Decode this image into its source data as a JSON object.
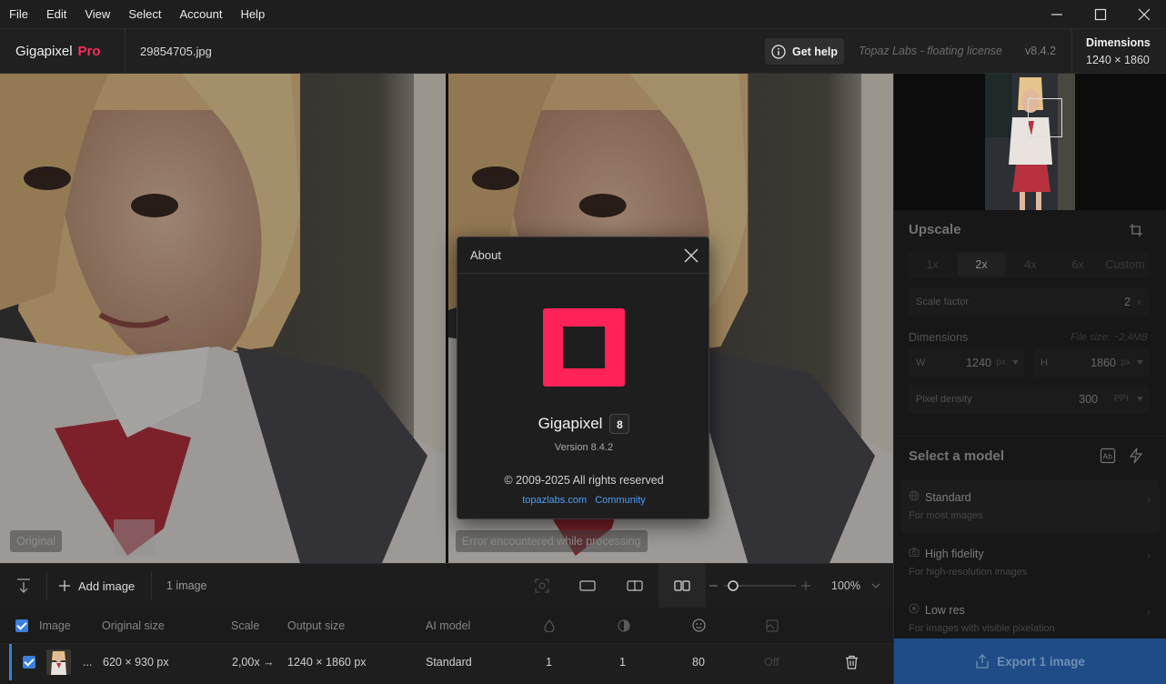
{
  "menu": [
    "File",
    "Edit",
    "View",
    "Select",
    "Account",
    "Help"
  ],
  "header": {
    "brand": "Gigapixel",
    "brand_tier": "Pro",
    "filename": "29854705.jpg",
    "get_help": "Get help",
    "license": "Topaz Labs - floating license",
    "version": "v8.4.2",
    "dimensions_title": "Dimensions",
    "dimensions_value": "1240 × 1860"
  },
  "canvas": {
    "left_tag": "Original",
    "right_tag": "Error encountered while processing"
  },
  "about": {
    "title": "About",
    "app_name": "Gigapixel",
    "major_version": "8",
    "version": "Version 8.4.2",
    "copyright": "© 2009-2025 All rights reserved",
    "link_site": "topazlabs.com",
    "link_community": "Community",
    "logo_color": "#ff2258"
  },
  "toolbar": {
    "add_image": "Add image",
    "image_count": "1 image",
    "zoom": "100%"
  },
  "table": {
    "headers": {
      "image": "Image",
      "original_size": "Original size",
      "scale": "Scale",
      "output_size": "Output size",
      "ai_model": "AI model"
    },
    "row": {
      "ellipsis": "...",
      "original_size": "620 × 930 px",
      "scale": "2,00x →",
      "output_size": "1240 × 1860 px",
      "ai_model": "Standard",
      "col1": "1",
      "col2": "1",
      "col3": "80",
      "col4": "Off"
    }
  },
  "sidebar": {
    "upscale_title": "Upscale",
    "scale_options": [
      "1x",
      "2x",
      "4x",
      "6x",
      "Custom"
    ],
    "scale_selected": "2x",
    "scale_factor_label": "Scale factor",
    "scale_factor_value": "2",
    "scale_factor_unit": "x",
    "dimensions_label": "Dimensions",
    "file_size": "File size: ~2,4MB",
    "w_label": "W",
    "w_value": "1240",
    "w_unit": "px",
    "h_label": "H",
    "h_value": "1860",
    "h_unit": "px",
    "pixel_density_label": "Pixel density",
    "pixel_density_value": "300",
    "pixel_density_unit": "PPI",
    "select_model_title": "Select a model",
    "models": [
      {
        "name": "Standard",
        "desc": "For most images"
      },
      {
        "name": "High fidelity",
        "desc": "For high-resolution images"
      },
      {
        "name": "Low res",
        "desc": "For images with visible pixelation"
      }
    ],
    "export_label": "Export 1 image"
  },
  "colors": {
    "accent": "#3b7fd9",
    "brand": "#ff2a5c"
  }
}
